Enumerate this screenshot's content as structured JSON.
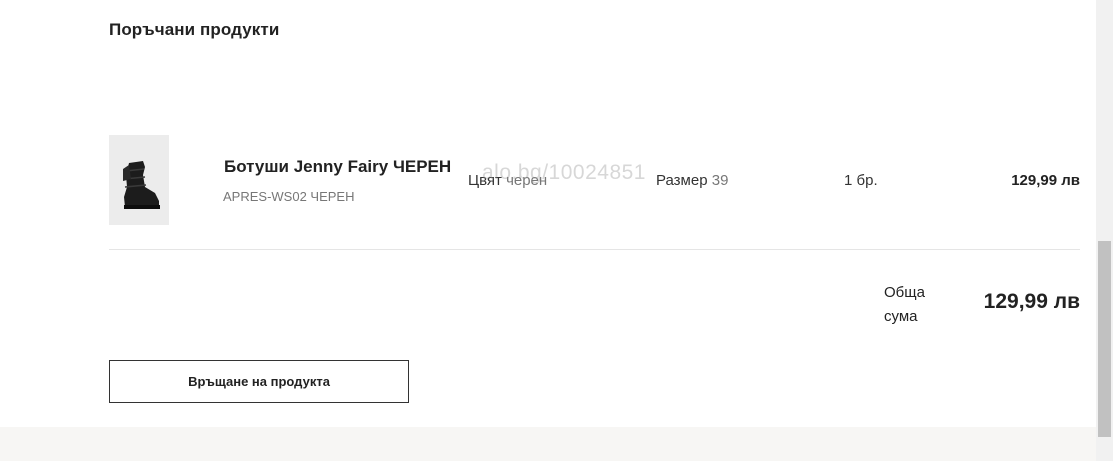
{
  "order": {
    "section_title": "Поръчани продукти",
    "items": [
      {
        "image_icon": "boot-product-image",
        "name": "Ботуши Jenny Fairy ЧЕРЕН",
        "sku": "APRES-WS02 ЧЕРЕН",
        "color_label": "Цвят",
        "color_value": "черен",
        "size_label": "Размер",
        "size_value": "39",
        "quantity": "1 бр.",
        "price": "129,99 лв"
      }
    ],
    "watermark": "alo.bg/10024851",
    "total_label": "Обща сума",
    "total_value": "129,99 лв",
    "return_button_label": "Връщане на продукта"
  },
  "colors": {
    "text": "#222222",
    "muted": "#777777",
    "divider": "#e5e5e5",
    "footer": "#f7f6f4"
  }
}
